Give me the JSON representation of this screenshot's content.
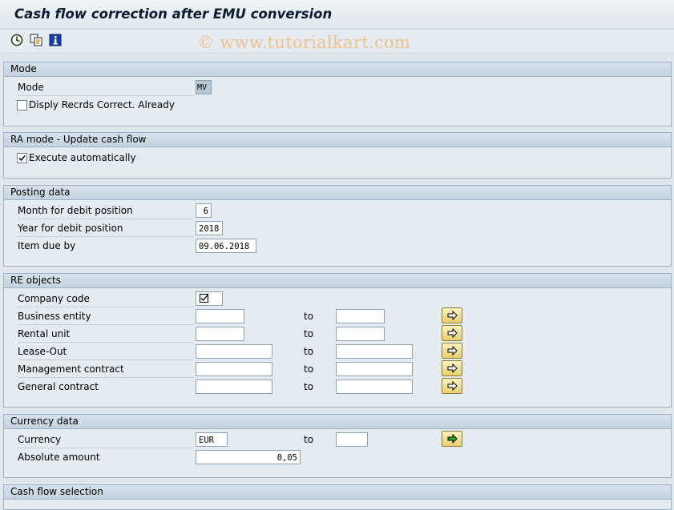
{
  "window": {
    "title": "Cash flow correction after EMU conversion"
  },
  "toolbar": {
    "icons": [
      "execute-icon",
      "get-variant-icon",
      "info-icon"
    ]
  },
  "watermark": "© www.tutorialkart.com",
  "mode_group": {
    "header": "Mode",
    "mode_label": "Mode",
    "mode_value": "MV",
    "display_checkbox_label": "Disply Recrds Correct. Already",
    "display_checked": false
  },
  "ra_group": {
    "header": "RA mode  - Update cash flow",
    "execute_label": "Execute automatically",
    "execute_checked": true
  },
  "posting_group": {
    "header": "Posting data",
    "month_label": "Month for debit position",
    "month_value": "6",
    "year_label": "Year for debit position",
    "year_value": "2018",
    "due_label": "Item due by",
    "due_value": "09.06.2018"
  },
  "re_group": {
    "header": "RE objects",
    "company_label": "Company code",
    "company_checked": true,
    "to_label": "to",
    "rows": [
      {
        "label": "Business entity",
        "from": "",
        "to": ""
      },
      {
        "label": "Rental unit",
        "from": "",
        "to": ""
      },
      {
        "label": "Lease-Out",
        "from": "",
        "to": ""
      },
      {
        "label": "Management contract",
        "from": "",
        "to": ""
      },
      {
        "label": "General contract",
        "from": "",
        "to": ""
      }
    ]
  },
  "currency_group": {
    "header": "Currency data",
    "currency_label": "Currency",
    "currency_from": "EUR",
    "currency_to": "",
    "to_label": "to",
    "amount_label": "Absolute amount",
    "amount_value": "0,05"
  },
  "cashflow_group": {
    "header": "Cash flow selection"
  }
}
